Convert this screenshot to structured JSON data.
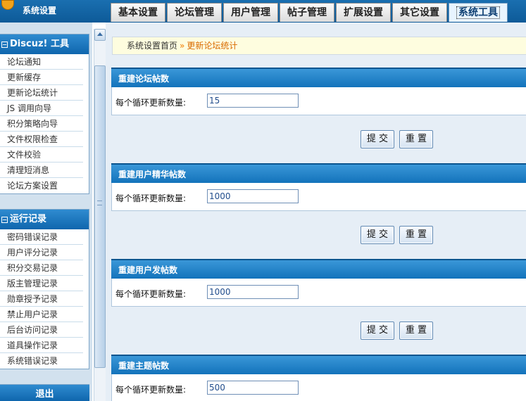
{
  "header": {
    "logo_text": "系统设置",
    "tabs": [
      {
        "label": "基本设置"
      },
      {
        "label": "论坛管理"
      },
      {
        "label": "用户管理"
      },
      {
        "label": "帖子管理"
      },
      {
        "label": "扩展设置"
      },
      {
        "label": "其它设置"
      },
      {
        "label": "系统工具",
        "active": true
      }
    ]
  },
  "sidebar": {
    "tools": {
      "title": "Discuz! 工具",
      "items": [
        "论坛通知",
        "更新缓存",
        "更新论坛统计",
        "JS 调用向导",
        "积分策略向导",
        "文件权限检查",
        "文件校验",
        "清理短消息",
        "论坛方案设置"
      ]
    },
    "logs": {
      "title": "运行记录",
      "items": [
        "密码错误记录",
        "用户评分记录",
        "积分交易记录",
        "版主管理记录",
        "勋章授予记录",
        "禁止用户记录",
        "后台访问记录",
        "道具操作记录",
        "系统错误记录"
      ]
    },
    "logout": "退出"
  },
  "breadcrumb": {
    "home": "系统设置首页",
    "separator": "»",
    "current": "更新论坛统计"
  },
  "sections": [
    {
      "title": "重建论坛帖数",
      "label": "每个循环更新数量:",
      "value": "15"
    },
    {
      "title": "重建用户精华帖数",
      "label": "每个循环更新数量:",
      "value": "1000"
    },
    {
      "title": "重建用户发帖数",
      "label": "每个循环更新数量:",
      "value": "1000"
    },
    {
      "title": "重建主题帖数",
      "label": "每个循环更新数量:",
      "value": "500"
    }
  ],
  "buttons": {
    "submit": "提 交",
    "reset": "重 置"
  }
}
